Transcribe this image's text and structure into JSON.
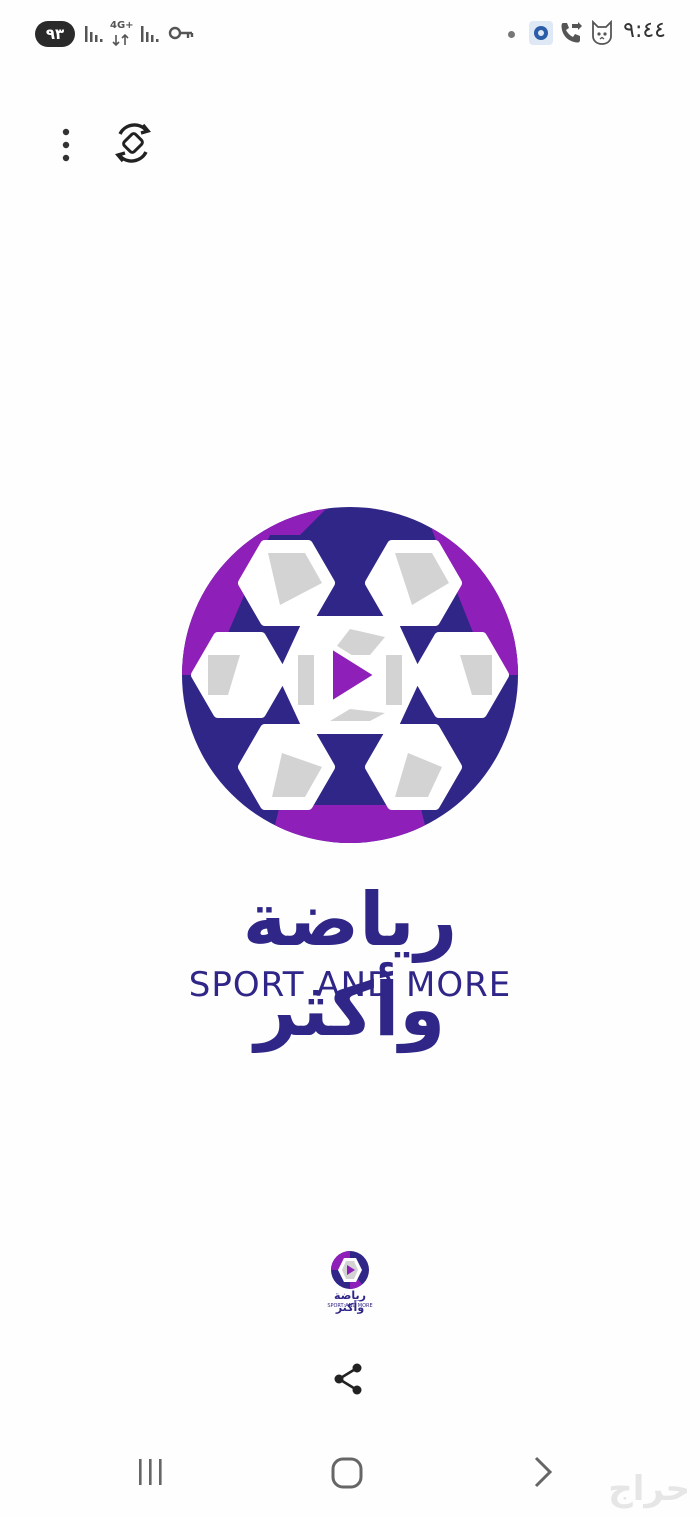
{
  "status_bar": {
    "battery": "٩٣",
    "network": "4G+",
    "time": "٩:٤٤"
  },
  "toolbar": {
    "menu_icon": "more-vert-icon",
    "rotate_icon": "screen-rotate-icon"
  },
  "logo": {
    "name_ar": "رياضة وأكثر",
    "name_en": "SPORT AND MORE"
  },
  "share_icon": "share-icon",
  "nav_bar": {
    "recents_icon": "recents-icon",
    "home_icon": "home-icon",
    "back_icon": "back-chevron-icon"
  },
  "watermark": "حراج",
  "colors": {
    "brand_purple": "#8e1fb8",
    "brand_navy": "#2f2687",
    "panel_grey": "#d3d3d3"
  }
}
